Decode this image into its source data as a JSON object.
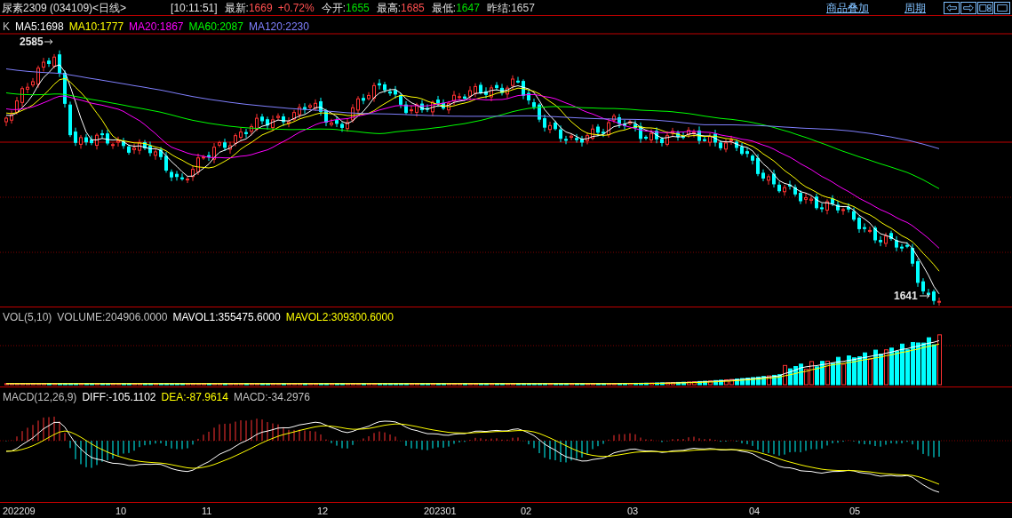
{
  "header": {
    "title": "尿素2309 (034109)<日线>",
    "time": "[10:11:51]",
    "quotes": [
      {
        "label": "最新:",
        "value": "1669",
        "change": "+0.72%",
        "color": "#ff5050"
      },
      {
        "label": "今开:",
        "value": "1655",
        "color": "#00e000"
      },
      {
        "label": "最高:",
        "value": "1685",
        "color": "#ff5050"
      },
      {
        "label": "最低:",
        "value": "1647",
        "color": "#00e000"
      },
      {
        "label": "昨结:",
        "value": "1657",
        "color": "#d0d0d0"
      }
    ],
    "links": [
      "商品叠加",
      "周期"
    ]
  },
  "price_pane": {
    "prefix": "K",
    "legend": [
      {
        "text": "MA5:1698",
        "color": "#ffffff"
      },
      {
        "text": "MA10:1777",
        "color": "#ffff00"
      },
      {
        "text": "MA20:1867",
        "color": "#ff00ff"
      },
      {
        "text": "MA60:2087",
        "color": "#00ff00"
      },
      {
        "text": "MA120:2230",
        "color": "#8080ff"
      }
    ],
    "high_label": "2585",
    "low_label": "1641"
  },
  "volume_pane": {
    "prefix": "VOL(5,10)",
    "legend": [
      {
        "text": "VOLUME:204906.0000",
        "color": "#c0c0c0"
      },
      {
        "text": "MAVOL1:355475.6000",
        "color": "#ffffff"
      },
      {
        "text": "MAVOL2:309300.6000",
        "color": "#ffff00"
      }
    ]
  },
  "macd_pane": {
    "prefix": "MACD(12,26,9)",
    "legend": [
      {
        "text": "DIFF:-105.1102",
        "color": "#ffffff"
      },
      {
        "text": "DEA:-87.9614",
        "color": "#ffff00"
      },
      {
        "text": "MACD:-34.2976",
        "color": "#c0c0c0"
      }
    ]
  },
  "x_axis": [
    "202209",
    "10",
    "11",
    "12",
    "202301",
    "02",
    "03",
    "04",
    "05"
  ]
}
